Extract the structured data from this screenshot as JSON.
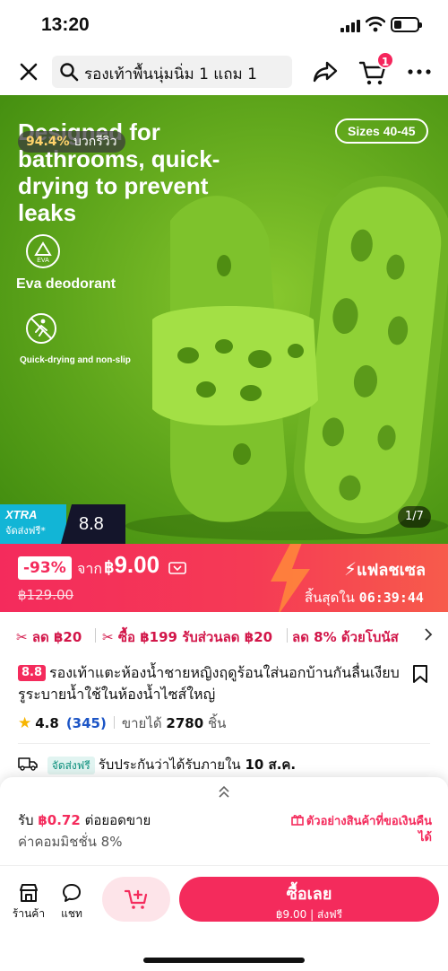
{
  "status_bar": {
    "time": "13:20",
    "battery_level": 0.35
  },
  "header": {
    "search_query": "รองเท้าพื้นนุ่มนิ่ม 1 แถม 1",
    "cart_count": "1"
  },
  "hero": {
    "headline": "Designed for bathrooms, quick-drying to prevent leaks",
    "rating_pct": "94.4%",
    "rating_label": "บวกรีวิว",
    "sizes": "Sizes 40-45",
    "eva_icon_label": "EVA",
    "eva_text": "Eva deodorant",
    "quick_text": "Quick-drying and non-slip",
    "xtra_label": "XTRA",
    "xtra_sub": "จัดส่งฟรี*",
    "xtra_date": "8.8",
    "image_counter": "1/7",
    "colors": {
      "slipper": "#8fd136",
      "background": "#5ea51b"
    }
  },
  "price": {
    "discount": "-93%",
    "from_label": "จาก",
    "currency": "฿",
    "amount": "9.00",
    "old_price": "฿129.00",
    "flash_label": "แฟลชเซล",
    "ends_label": "สิ้นสุดใน",
    "countdown": "06:39:44"
  },
  "promos": [
    {
      "icon": "coupon-icon",
      "text": "ลด ฿20"
    },
    {
      "icon": "coupon-icon",
      "text": "ซื้อ ฿199 รับส่วนลด ฿20"
    },
    {
      "icon": "",
      "text": "ลด 8% ด้วยโบนัส"
    }
  ],
  "product": {
    "badge": "8.8",
    "title": "รองเท้าแตะห้องน้ำชายหญิงฤดูร้อนใส่นอกบ้านกันลื่นเงียบรูระบายน้ำใช้ในห้องน้ำไซส์ใหญ่",
    "rating": "4.8",
    "reviews": "(345)",
    "sold_label": "ขายได้",
    "sold_count": "2780",
    "sold_unit": "ชิ้น"
  },
  "shipping": {
    "tag": "จัดส่งฟรี",
    "text": "รับประกันว่าได้รับภายใน",
    "date": "10 ส.ค."
  },
  "affiliate": {
    "earn_label": "รับ",
    "earn_amount": "฿0.72",
    "earn_suffix": "ต่อยอดขาย",
    "commission": "ค่าคอมมิชชั่น 8%",
    "sample_link": "ตัวอย่างสินค้าที่ขอเงินคืนได้"
  },
  "bottom_bar": {
    "shop_label": "ร้านค้า",
    "chat_label": "แชท",
    "buy_label": "ซื้อเลย",
    "buy_sub": "฿9.00 | ส่งฟรี"
  }
}
